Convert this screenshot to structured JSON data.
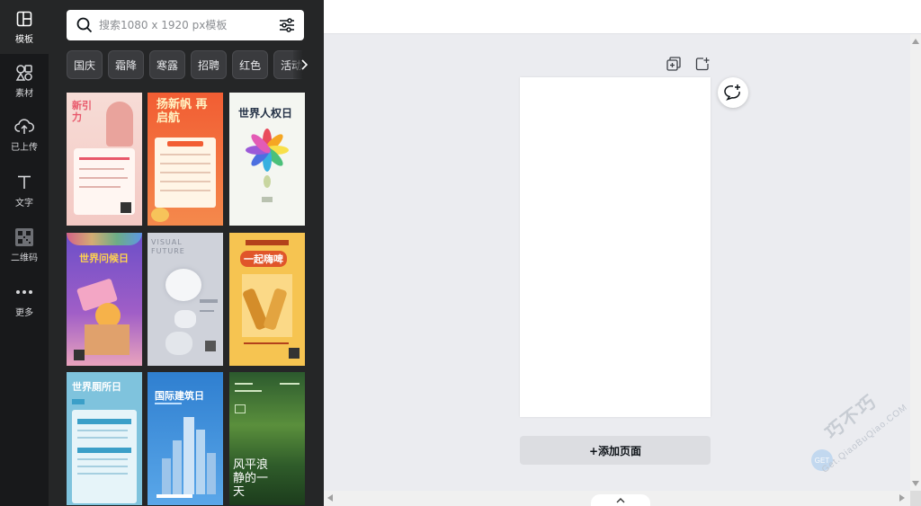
{
  "rail": {
    "items": [
      {
        "label": "模板",
        "icon": "template-icon",
        "active": true
      },
      {
        "label": "素材",
        "icon": "elements-icon",
        "active": false
      },
      {
        "label": "已上传",
        "icon": "upload-cloud-icon",
        "active": false
      },
      {
        "label": "文字",
        "icon": "text-icon",
        "active": false
      },
      {
        "label": "二维码",
        "icon": "qrcode-icon",
        "active": false
      },
      {
        "label": "更多",
        "icon": "more-dots-icon",
        "active": false
      }
    ]
  },
  "panel": {
    "search_placeholder": "搜索1080 x 1920 px模板",
    "chips": [
      "国庆",
      "霜降",
      "寒露",
      "招聘",
      "红色",
      "活动"
    ],
    "templates": [
      {
        "title": "新引力",
        "bg": "#f6d8d2",
        "accent": "#e8576a"
      },
      {
        "title": "扬新帆 再启航",
        "bg": "#f26b3a",
        "accent": "#fff3c2"
      },
      {
        "title": "世界人权日",
        "bg": "#f4f6f1",
        "accent": "#243247"
      },
      {
        "title": "世界问候日",
        "bg": "#8a57c7",
        "accent": "#ffd34f"
      },
      {
        "title": "VISUAL FUTURE",
        "bg": "#cfd2da",
        "accent": "#8a8f9c"
      },
      {
        "title": "一起嗨啤",
        "bg": "#f6c451",
        "accent": "#b3411b"
      },
      {
        "title": "世界厕所日",
        "bg": "#7fc3dd",
        "accent": "#ffffff"
      },
      {
        "title": "国际建筑日",
        "bg": "#3f8fd9",
        "accent": "#ffffff"
      },
      {
        "title": "风平浪静的一天",
        "bg": "#3e6b36",
        "accent": "#ffffff"
      }
    ]
  },
  "editor": {
    "add_page_label": "+添加页面"
  },
  "watermark": {
    "cn": "巧不巧",
    "en": "Get.QiaoBuQiao.COM",
    "badge": "GET"
  }
}
